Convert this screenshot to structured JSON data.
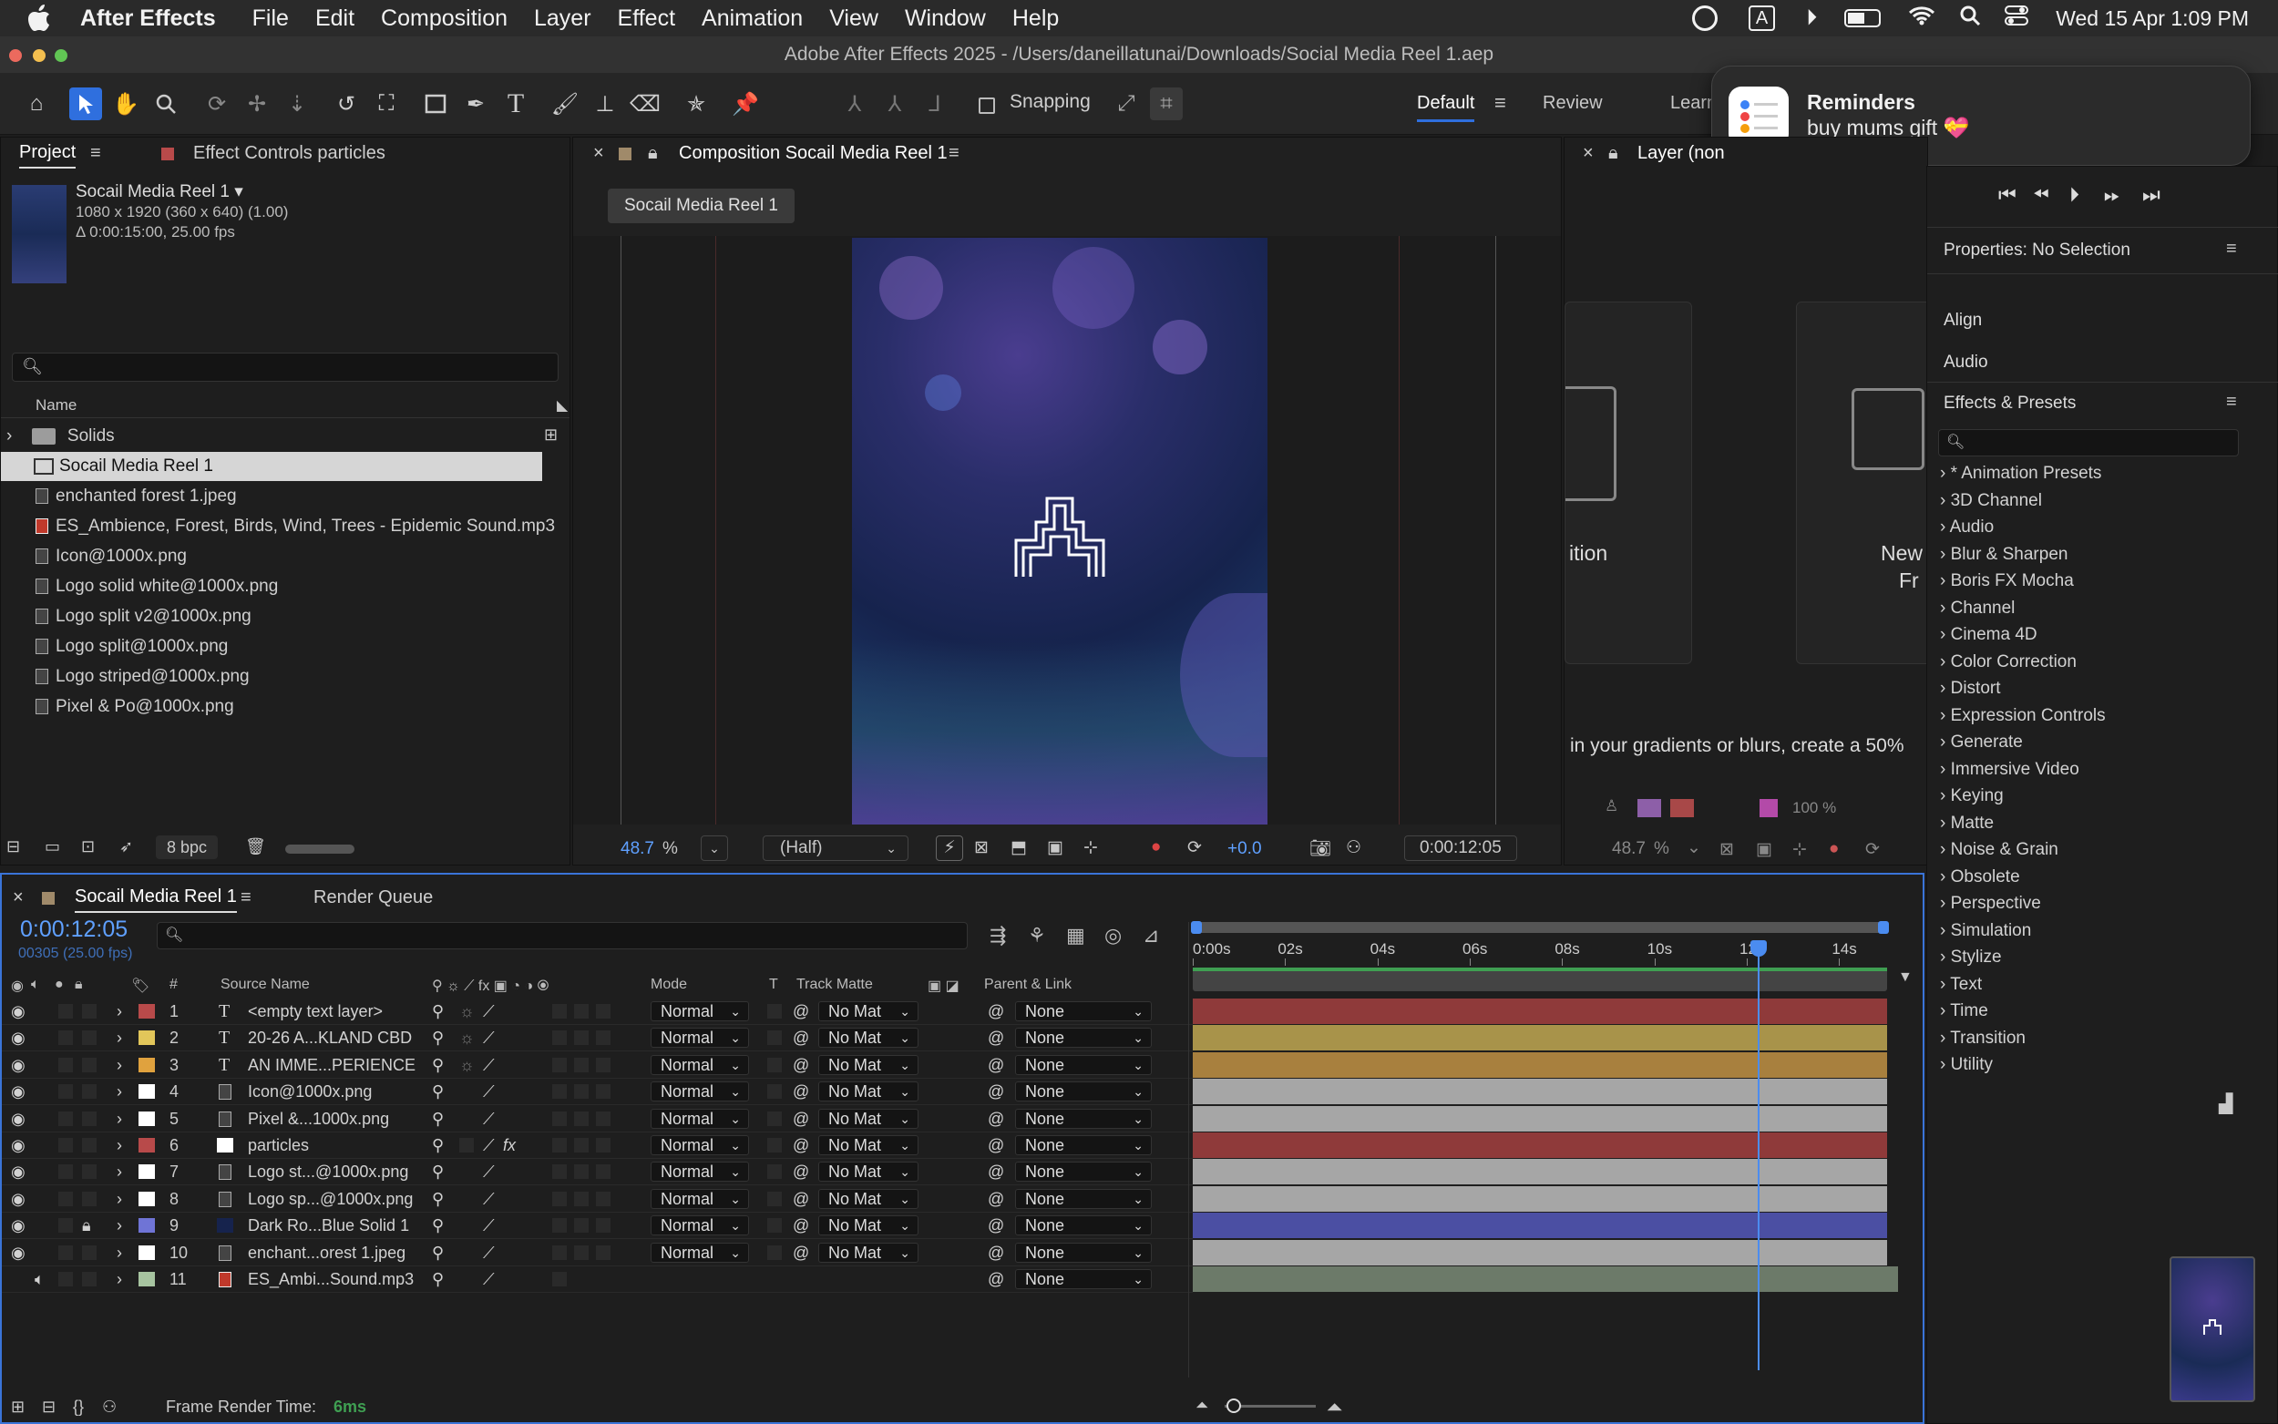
{
  "menubar": {
    "app": "After Effects",
    "menus": [
      "File",
      "Edit",
      "Composition",
      "Layer",
      "Effect",
      "Animation",
      "View",
      "Window",
      "Help"
    ],
    "input_badge": "A",
    "clock": "Wed 15 Apr  1:09 PM"
  },
  "window": {
    "title": "Adobe After Effects 2025 - /Users/daneillatunai/Downloads/Social Media Reel 1.aep"
  },
  "toolbar": {
    "snapping_label": "Snapping",
    "workspaces": [
      "Default",
      "Review",
      "Learn"
    ]
  },
  "notification": {
    "app": "Reminders",
    "body": "buy mums gift 💝"
  },
  "project": {
    "tab_project": "Project",
    "tab_effect_controls": "Effect Controls particles",
    "comp_name": "Socail Media Reel 1 ▾",
    "comp_res": "1080 x 1920  (360 x 640) (1.00)",
    "comp_dur": "Δ 0:00:15:00, 25.00 fps",
    "col_name": "Name",
    "items": [
      {
        "name": "Solids",
        "type": "folder"
      },
      {
        "name": "Socail Media Reel 1",
        "type": "comp"
      },
      {
        "name": "enchanted forest 1.jpeg",
        "type": "image"
      },
      {
        "name": "ES_Ambience, Forest, Birds, Wind, Trees - Epidemic Sound.mp3",
        "type": "audio"
      },
      {
        "name": "Icon@1000x.png",
        "type": "image"
      },
      {
        "name": "Logo solid white@1000x.png",
        "type": "image"
      },
      {
        "name": "Logo split v2@1000x.png",
        "type": "image"
      },
      {
        "name": "Logo split@1000x.png",
        "type": "image"
      },
      {
        "name": "Logo striped@1000x.png",
        "type": "image"
      },
      {
        "name": "Pixel & Po@1000x.png",
        "type": "image"
      }
    ],
    "bpc": "8 bpc"
  },
  "composition": {
    "tab": "Composition Socail Media Reel 1",
    "breadcrumb": "Socail Media Reel 1",
    "zoom": "48.7",
    "zoom_unit": "%",
    "resolution": "(Half)",
    "exposure": "+0.0",
    "timecode": "0:00:12:05"
  },
  "layer_panel": {
    "tab": "Layer (non",
    "text_ition": "ition",
    "text_new": "New",
    "text_fr": "Fr",
    "tip": "in your gradients or blurs, create a 50%",
    "pct": "100 %",
    "zoom": "48.7",
    "zoom_unit": "%"
  },
  "right_panel": {
    "properties": "Properties: No Selection",
    "align": "Align",
    "audio": "Audio",
    "effects_presets": "Effects & Presets",
    "effects": [
      "* Animation Presets",
      "3D Channel",
      "Audio",
      "Blur & Sharpen",
      "Boris FX Mocha",
      "Channel",
      "Cinema 4D",
      "Color Correction",
      "Distort",
      "Expression Controls",
      "Generate",
      "Immersive Video",
      "Keying",
      "Matte",
      "Noise & Grain",
      "Obsolete",
      "Perspective",
      "Simulation",
      "Stylize",
      "Text",
      "Time",
      "Transition",
      "Utility"
    ]
  },
  "timeline": {
    "tab": "Socail Media Reel 1",
    "render_queue": "Render Queue",
    "timecode": "0:00:12:05",
    "frames": "00305 (25.00 fps)",
    "headers": {
      "num": "#",
      "source": "Source Name",
      "mode": "Mode",
      "t": "T",
      "track_matte": "Track Matte",
      "parent": "Parent & Link"
    },
    "ruler": [
      "0:00s",
      "02s",
      "04s",
      "06s",
      "08s",
      "10s",
      "12s",
      "14s"
    ],
    "playhead_seconds": 12.2,
    "duration_seconds": 15,
    "layers": [
      {
        "num": "1",
        "label": "#b84a4a",
        "type": "T",
        "name": "<empty text layer>",
        "mode": "Normal",
        "matte": "No Mat",
        "parent": "None",
        "bar": "#8f3a3a"
      },
      {
        "num": "2",
        "label": "#e2c65a",
        "type": "T",
        "name": "20-26 A...KLAND CBD",
        "mode": "Normal",
        "matte": "No Mat",
        "parent": "None",
        "bar": "#a8934a"
      },
      {
        "num": "3",
        "label": "#e0a23e",
        "type": "T",
        "name": "AN IMME...PERIENCE",
        "mode": "Normal",
        "matte": "No Mat",
        "parent": "None",
        "bar": "#a8803e"
      },
      {
        "num": "4",
        "label": "#ffffff",
        "type": "img",
        "name": "Icon@1000x.png",
        "mode": "Normal",
        "matte": "No Mat",
        "parent": "None",
        "bar": "#a6a6a6"
      },
      {
        "num": "5",
        "label": "#ffffff",
        "type": "img",
        "name": "Pixel &...1000x.png",
        "mode": "Normal",
        "matte": "No Mat",
        "parent": "None",
        "bar": "#a6a6a6"
      },
      {
        "num": "6",
        "label": "#b84a4a",
        "type": "solid",
        "name": "particles",
        "mode": "Normal",
        "matte": "No Mat",
        "parent": "None",
        "bar": "#8f3a3a"
      },
      {
        "num": "7",
        "label": "#ffffff",
        "type": "img",
        "name": "Logo st...@1000x.png",
        "mode": "Normal",
        "matte": "No Mat",
        "parent": "None",
        "bar": "#a6a6a6"
      },
      {
        "num": "8",
        "label": "#ffffff",
        "type": "img",
        "name": "Logo sp...@1000x.png",
        "mode": "Normal",
        "matte": "No Mat",
        "parent": "None",
        "bar": "#a6a6a6"
      },
      {
        "num": "9",
        "label": "#6f74d6",
        "type": "solid",
        "name": "Dark Ro...Blue Solid 1",
        "mode": "Normal",
        "matte": "No Mat",
        "parent": "None",
        "bar": "#4b4fa3"
      },
      {
        "num": "10",
        "label": "#ffffff",
        "type": "img",
        "name": "enchant...orest 1.jpeg",
        "mode": "Normal",
        "matte": "No Mat",
        "parent": "None",
        "bar": "#a6a6a6"
      },
      {
        "num": "11",
        "label": "#a7c4a0",
        "type": "audio",
        "name": "ES_Ambi...Sound.mp3",
        "mode": "",
        "matte": "",
        "parent": "None",
        "bar": "#6c7a69"
      }
    ],
    "footer_label": "Frame Render Time:",
    "footer_value": "6ms"
  }
}
